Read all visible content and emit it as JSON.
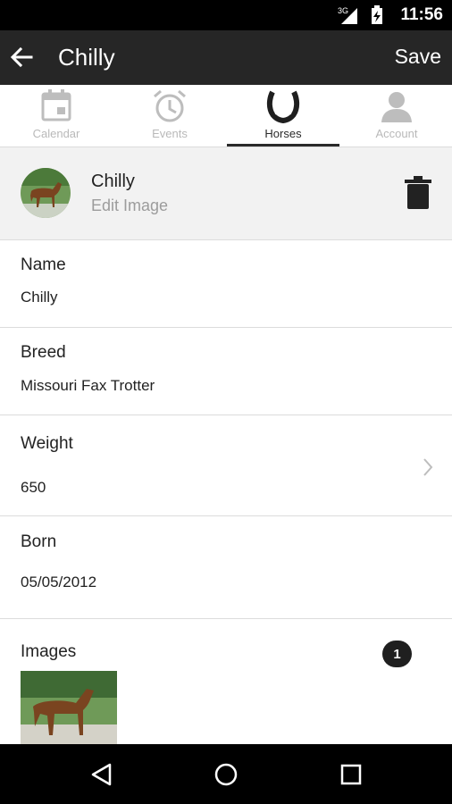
{
  "status_bar": {
    "time": "11:56",
    "network": "3G"
  },
  "toolbar": {
    "title": "Chilly",
    "save_label": "Save"
  },
  "tabs": [
    {
      "label": "Calendar",
      "icon": "calendar-icon",
      "active": false
    },
    {
      "label": "Events",
      "icon": "alarm-clock-icon",
      "active": false
    },
    {
      "label": "Horses",
      "icon": "horseshoe-icon",
      "active": true
    },
    {
      "label": "Account",
      "icon": "person-icon",
      "active": false
    }
  ],
  "profile": {
    "name": "Chilly",
    "edit_image_label": "Edit Image"
  },
  "fields": {
    "name": {
      "label": "Name",
      "value": "Chilly"
    },
    "breed": {
      "label": "Breed",
      "value": "Missouri Fax Trotter"
    },
    "weight": {
      "label": "Weight",
      "value": "650"
    },
    "born": {
      "label": "Born",
      "value": "05/05/2012"
    }
  },
  "images": {
    "label": "Images",
    "count": "1"
  }
}
